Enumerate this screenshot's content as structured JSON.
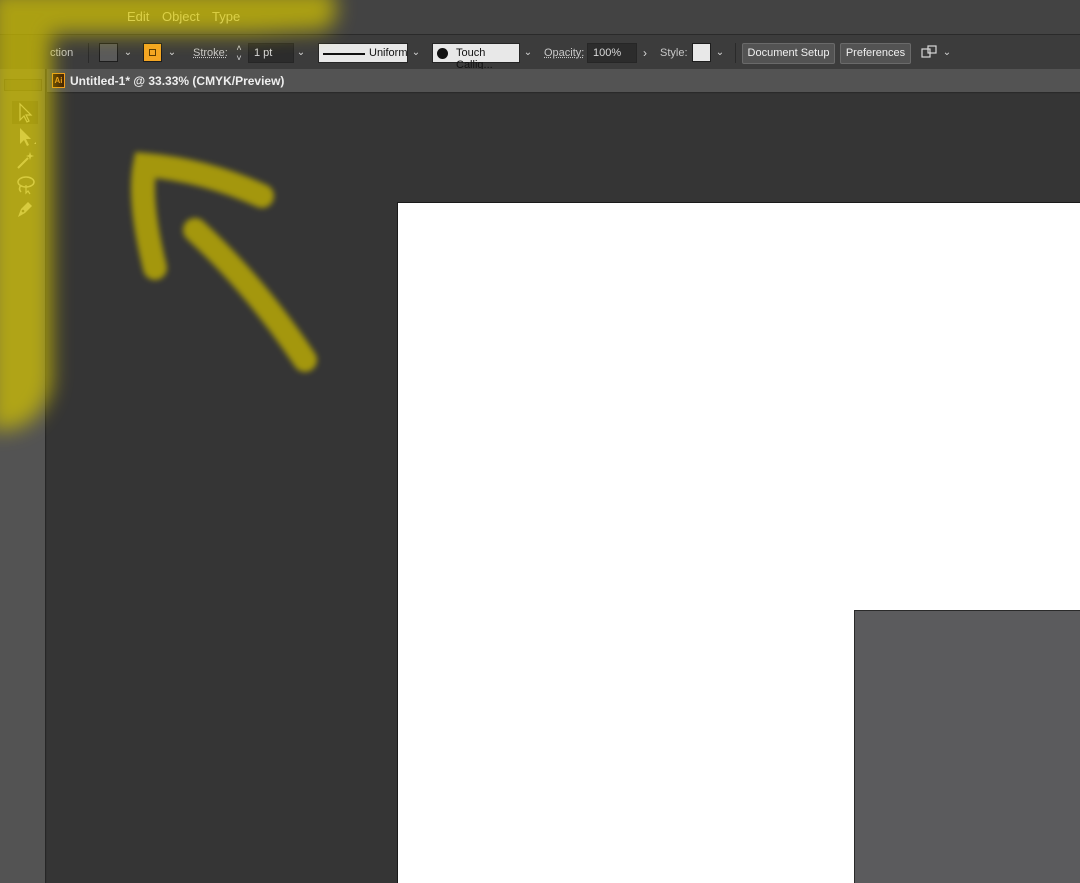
{
  "menubar": {
    "items": [
      "Edit",
      "Object",
      "Type"
    ]
  },
  "controlbar": {
    "selection_label": "ction",
    "stroke_label": "Stroke:",
    "stroke_weight": "1 pt",
    "profile_label": "Uniform",
    "brush_label": "Touch Callig...",
    "opacity_label": "Opacity:",
    "opacity_value": "100%",
    "style_label": "Style:",
    "document_setup": "Document Setup",
    "preferences": "Preferences"
  },
  "document": {
    "icon_text": "Ai",
    "title": "Untitled-1* @ 33.33% (CMYK/Preview)"
  },
  "tools": [
    "selection-tool",
    "direct-selection-tool",
    "magic-wand-tool",
    "lasso-tool",
    "pen-tool"
  ],
  "colors": {
    "highlight": "#d4c400",
    "fill_swatch": "#5a5a5a",
    "stroke_swatch": "#f5a623",
    "artboard": "#ffffff"
  }
}
